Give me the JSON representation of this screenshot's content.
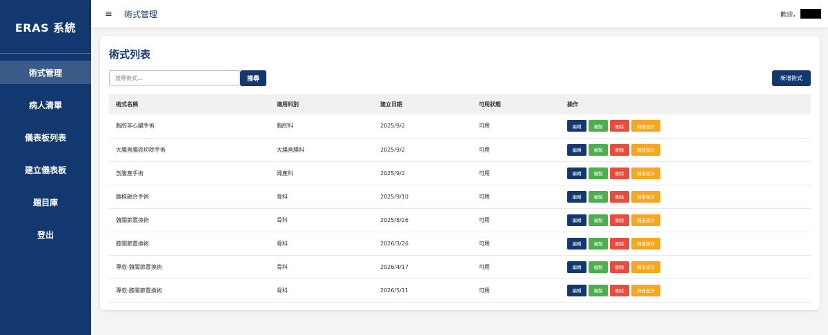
{
  "sidebar": {
    "brand": "ERAS 系統",
    "items": [
      {
        "label": "術式管理",
        "active": true
      },
      {
        "label": "病人清單"
      },
      {
        "label": "儀表板列表"
      },
      {
        "label": "建立儀表板"
      },
      {
        "label": "題目庫"
      },
      {
        "label": "登出"
      }
    ]
  },
  "topbar": {
    "menu_icon": "≡",
    "title": "術式管理",
    "welcome": "歡迎，"
  },
  "card": {
    "title": "術式列表",
    "search_placeholder": "搜尋術式...",
    "search_button": "搜尋",
    "add_button": "新增術式",
    "columns": [
      "術式名稱",
      "適用科別",
      "建立日期",
      "可用狀態",
      "操作"
    ],
    "action_labels": {
      "edit": "編輯",
      "copy": "複製",
      "delete": "刪除",
      "design": "問卷設計"
    },
    "rows": [
      {
        "name": "胸腔非心臟手術",
        "dept": "胸腔科",
        "date": "2025/9/2",
        "status": "可用"
      },
      {
        "name": "大腸直腸癌切除手術",
        "dept": "大腸直腸科",
        "date": "2025/9/2",
        "status": "可用"
      },
      {
        "name": "剖腹產手術",
        "dept": "婦產科",
        "date": "2025/9/2",
        "status": "可用"
      },
      {
        "name": "腰椎融合手術",
        "dept": "骨科",
        "date": "2025/9/10",
        "status": "可用"
      },
      {
        "name": "髖關節置換術",
        "dept": "骨科",
        "date": "2025/8/26",
        "status": "可用"
      },
      {
        "name": "膝關節置換術",
        "dept": "骨科",
        "date": "2026/3/26",
        "status": "可用"
      },
      {
        "name": "專款-髖關節置換術",
        "dept": "骨科",
        "date": "2026/4/17",
        "status": "可用"
      },
      {
        "name": "專款-膝關節置換術",
        "dept": "骨科",
        "date": "2026/5/11",
        "status": "可用"
      }
    ]
  },
  "colors": {
    "primary": "#13386f",
    "sidebar_active": "#3a5a88",
    "copy": "#4cae4f",
    "delete": "#e74c3c",
    "design": "#f5a623"
  }
}
